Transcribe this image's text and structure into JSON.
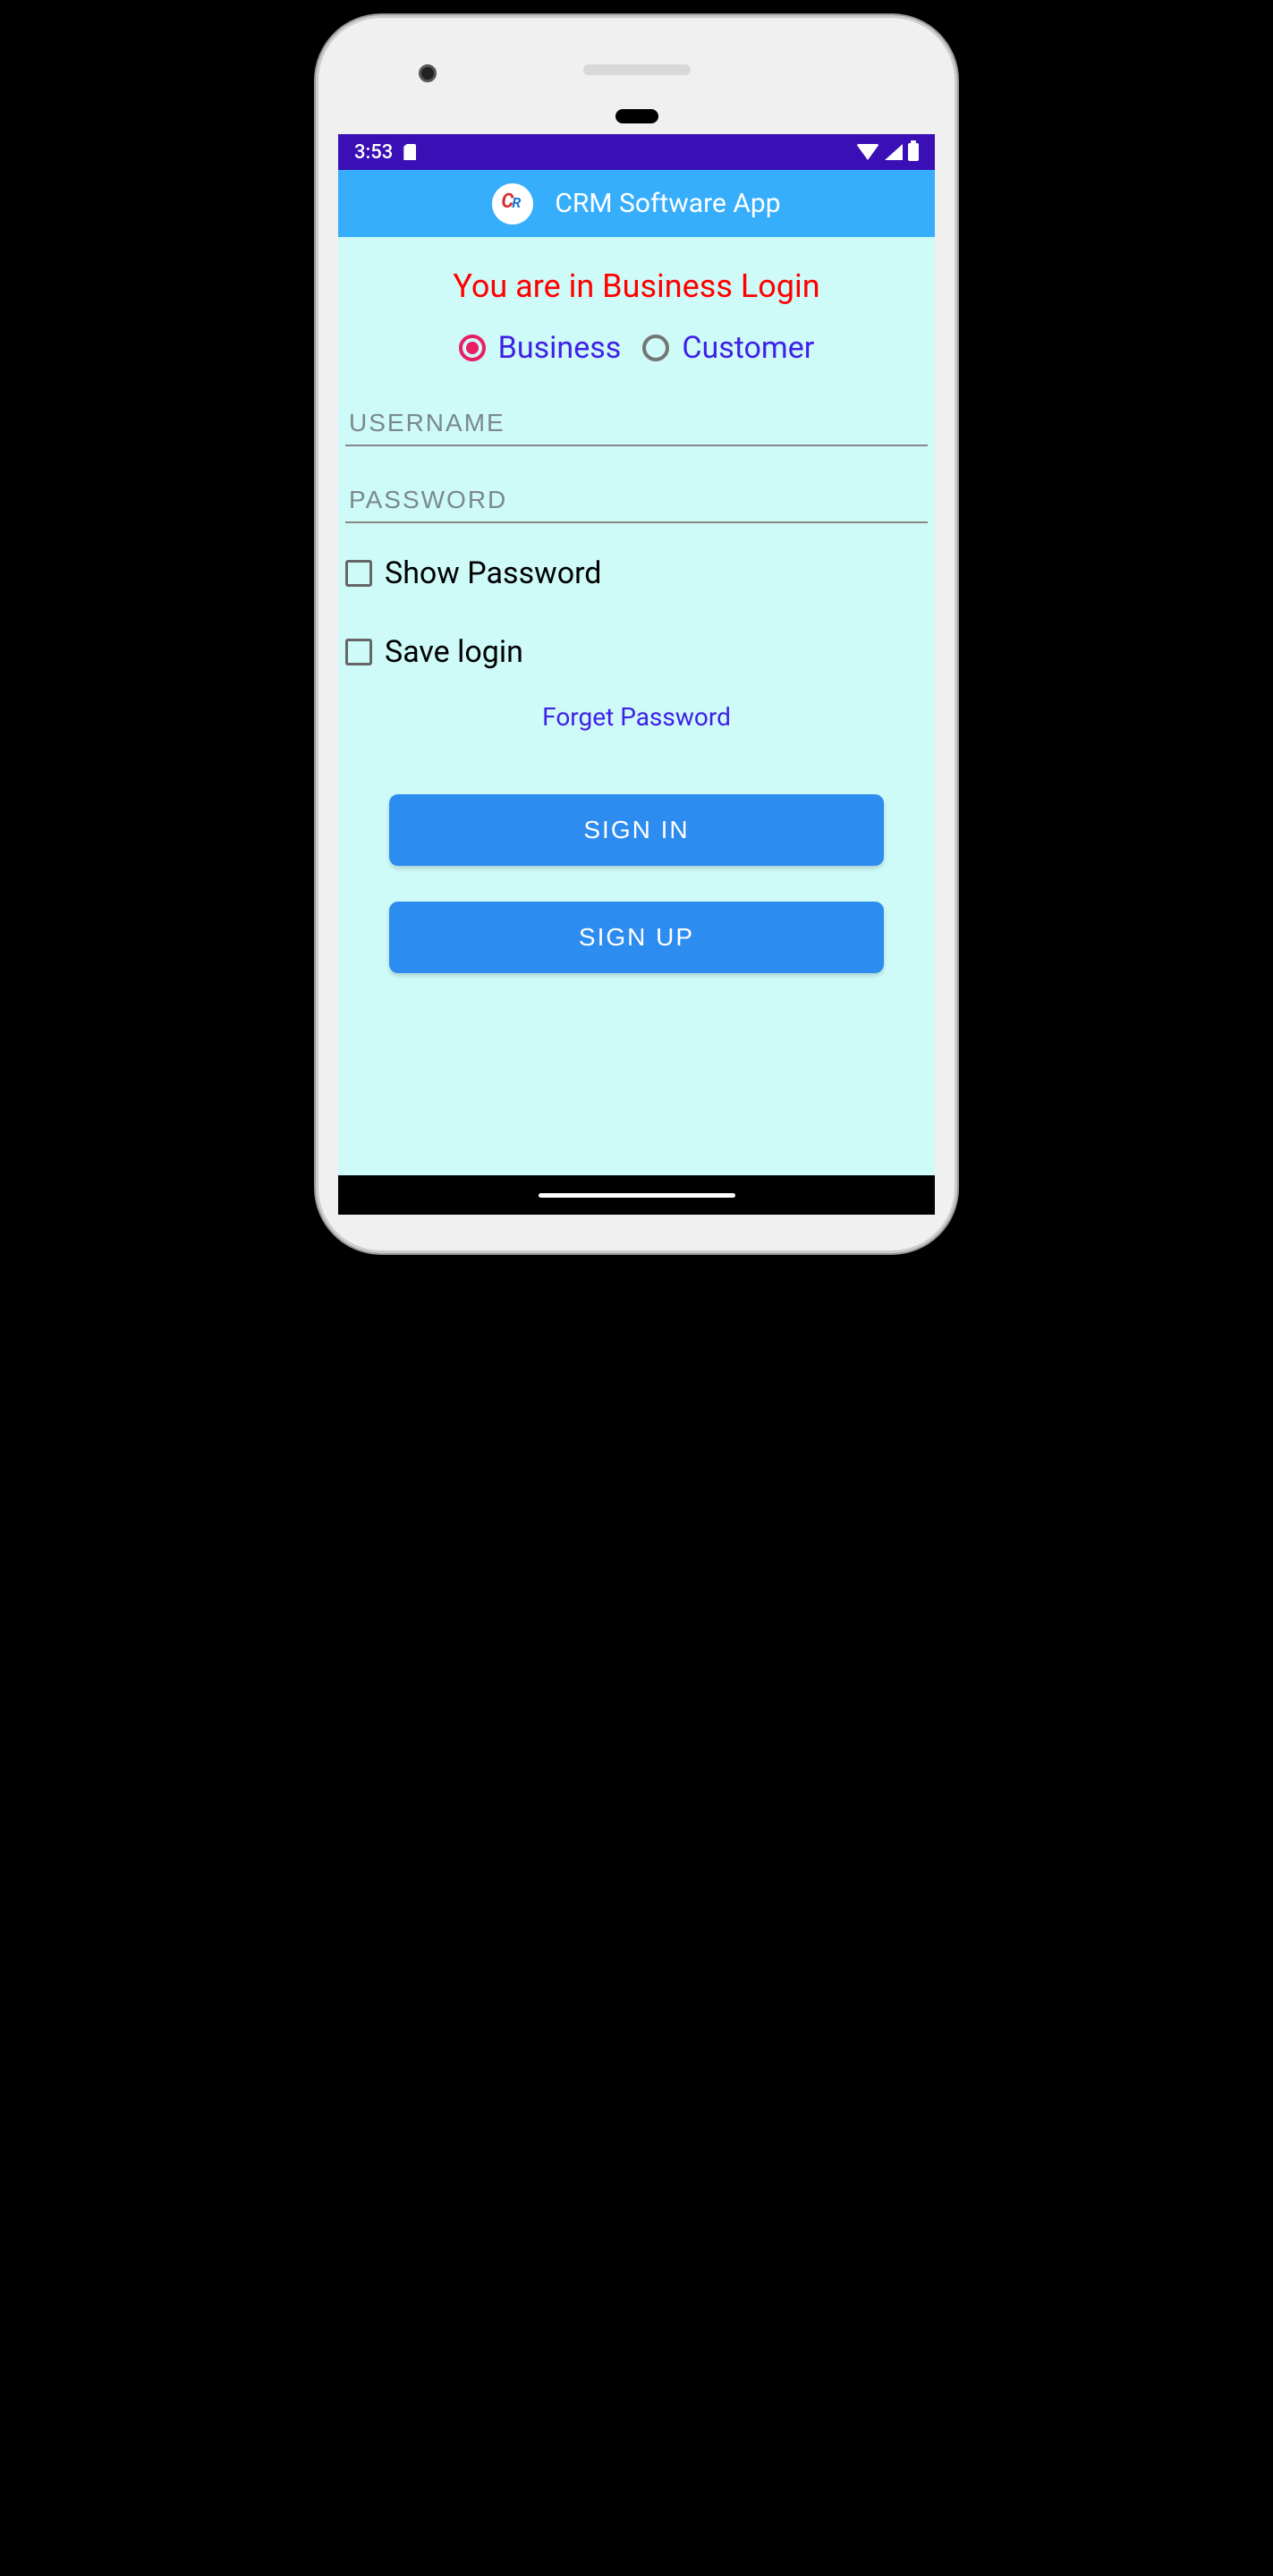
{
  "status": {
    "time": "3:53"
  },
  "appbar": {
    "title": "CRM Software App"
  },
  "heading": "You are in Business Login",
  "radios": {
    "business": "Business",
    "customer": "Customer"
  },
  "inputs": {
    "username_placeholder": "USERNAME",
    "password_placeholder": "PASSWORD"
  },
  "checkboxes": {
    "show_password": "Show Password",
    "save_login": "Save login"
  },
  "links": {
    "forget": "Forget Password"
  },
  "buttons": {
    "signin": "SIGN IN",
    "signup": "SIGN UP"
  }
}
